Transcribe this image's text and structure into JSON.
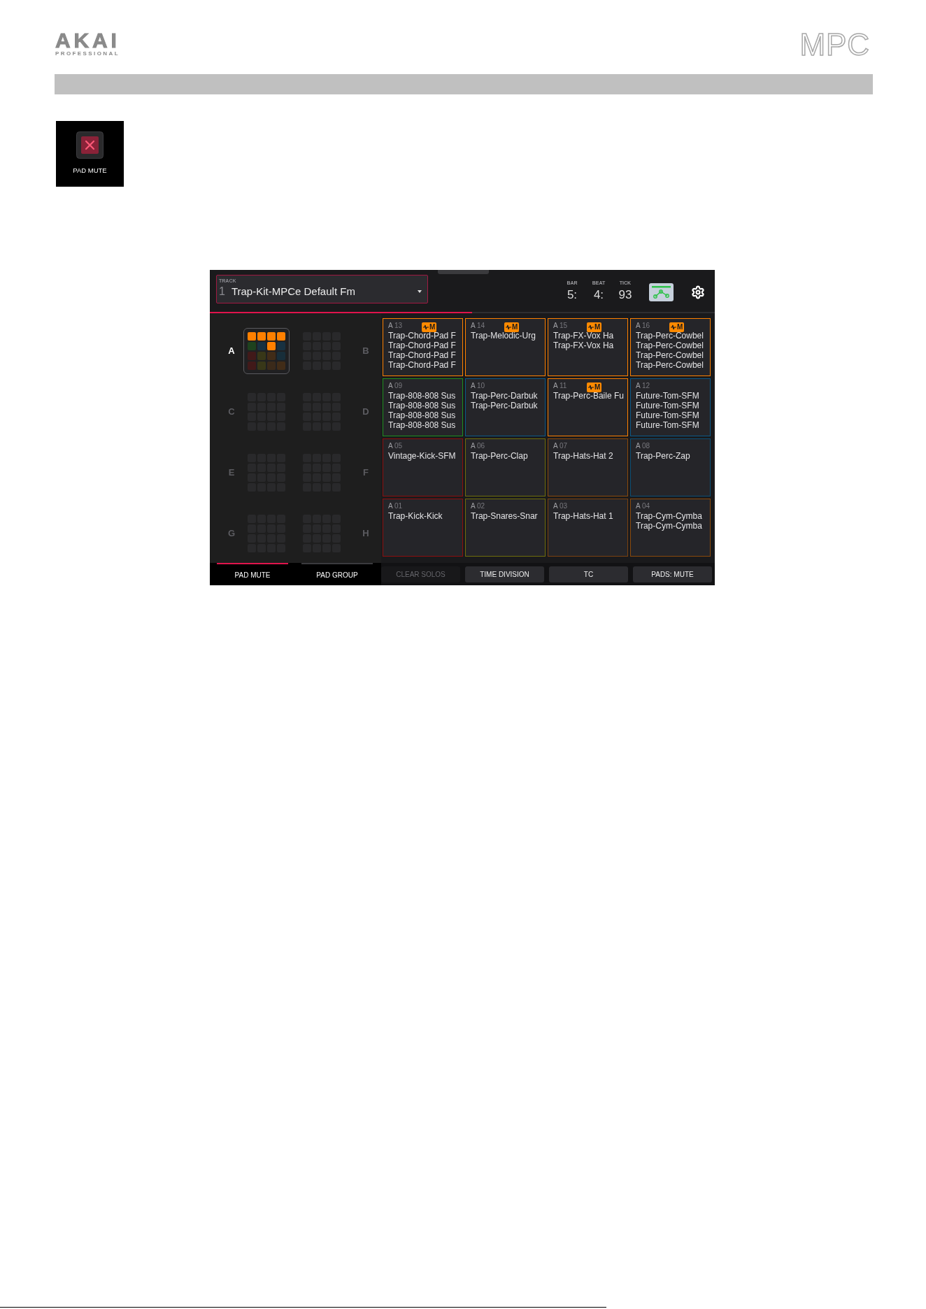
{
  "header": {
    "brand": "AKAI",
    "brand_sub": "PROFESSIONAL",
    "product": "MPC"
  },
  "mode_tile": {
    "label": "PAD MUTE"
  },
  "screen": {
    "track": {
      "caption": "TRACK",
      "number": "1",
      "name": "Trap-Kit-MPCe Default Fm"
    },
    "position": [
      {
        "caption": "BAR",
        "value": "5:"
      },
      {
        "caption": "BEAT",
        "value": "4:"
      },
      {
        "caption": "TICK",
        "value": "93"
      }
    ],
    "progress": {
      "level": 0.52
    },
    "banks": [
      {
        "letter": "A",
        "selected": true
      },
      {
        "letter": "B",
        "selected": false
      },
      {
        "letter": "C",
        "selected": false
      },
      {
        "letter": "D",
        "selected": false
      },
      {
        "letter": "E",
        "selected": false
      },
      {
        "letter": "F",
        "selected": false
      },
      {
        "letter": "G",
        "selected": false
      },
      {
        "letter": "H",
        "selected": false
      }
    ],
    "pads": [
      {
        "bank": "A",
        "number": "13",
        "muted": true,
        "badge": "M",
        "color": "#ff8000",
        "samples": [
          "Trap-Chord-Pad F",
          "Trap-Chord-Pad F",
          "Trap-Chord-Pad F",
          "Trap-Chord-Pad F"
        ]
      },
      {
        "bank": "A",
        "number": "14",
        "muted": true,
        "badge": "M",
        "color": "#ff8000",
        "samples": [
          "Trap-Melodic-Urg"
        ]
      },
      {
        "bank": "A",
        "number": "15",
        "muted": true,
        "badge": "M",
        "color": "#ff8000",
        "samples": [
          "Trap-FX-Vox Ha",
          "Trap-FX-Vox Ha"
        ]
      },
      {
        "bank": "A",
        "number": "16",
        "muted": true,
        "badge": "M",
        "color": "#ff8000",
        "samples": [
          "Trap-Perc-Cowbel",
          "Trap-Perc-Cowbel",
          "Trap-Perc-Cowbel",
          "Trap-Perc-Cowbel"
        ]
      },
      {
        "bank": "A",
        "number": "09",
        "muted": false,
        "color": "#1f8f1f",
        "samples": [
          "Trap-808-808 Sus",
          "Trap-808-808 Sus",
          "Trap-808-808 Sus",
          "Trap-808-808 Sus"
        ]
      },
      {
        "bank": "A",
        "number": "10",
        "muted": false,
        "color": "#0c5a8a",
        "samples": [
          "Trap-Perc-Darbuk",
          "Trap-Perc-Darbuk"
        ]
      },
      {
        "bank": "A",
        "number": "11",
        "muted": true,
        "badge": "M",
        "color": "#ff8000",
        "samples": [
          "Trap-Perc-Baile Fu"
        ]
      },
      {
        "bank": "A",
        "number": "12",
        "muted": false,
        "color": "#0c5a8a",
        "samples": [
          "Future-Tom-SFM",
          "Future-Tom-SFM",
          "Future-Tom-SFM",
          "Future-Tom-SFM"
        ]
      },
      {
        "bank": "A",
        "number": "05",
        "muted": false,
        "color": "#8c0f0f",
        "samples": [
          "Vintage-Kick-SFM"
        ]
      },
      {
        "bank": "A",
        "number": "06",
        "muted": false,
        "color": "#6f6d0c",
        "samples": [
          "Trap-Perc-Clap"
        ]
      },
      {
        "bank": "A",
        "number": "07",
        "muted": false,
        "color": "#8a4a0c",
        "samples": [
          "Trap-Hats-Hat 2"
        ]
      },
      {
        "bank": "A",
        "number": "08",
        "muted": false,
        "color": "#0c4f75",
        "samples": [
          "Trap-Perc-Zap"
        ]
      },
      {
        "bank": "A",
        "number": "01",
        "muted": false,
        "color": "#8c0f0f",
        "samples": [
          "Trap-Kick-Kick"
        ]
      },
      {
        "bank": "A",
        "number": "02",
        "muted": false,
        "color": "#6f6d0c",
        "samples": [
          "Trap-Snares-Snar"
        ]
      },
      {
        "bank": "A",
        "number": "03",
        "muted": false,
        "color": "#7a4210",
        "samples": [
          "Trap-Hats-Hat 1"
        ]
      },
      {
        "bank": "A",
        "number": "04",
        "muted": false,
        "color": "#8a4a0c",
        "samples": [
          "Trap-Cym-Cymba",
          "Trap-Cym-Cymba"
        ]
      }
    ],
    "tabs": [
      {
        "label": "PAD MUTE",
        "selected": true
      },
      {
        "label": "PAD GROUP",
        "selected": false
      }
    ],
    "buttons": [
      {
        "label": "CLEAR SOLOS",
        "disabled": true
      },
      {
        "label": "TIME DIVISION",
        "disabled": false
      },
      {
        "label": "TC",
        "disabled": false
      },
      {
        "label": "PADS: MUTE",
        "disabled": false
      }
    ]
  }
}
